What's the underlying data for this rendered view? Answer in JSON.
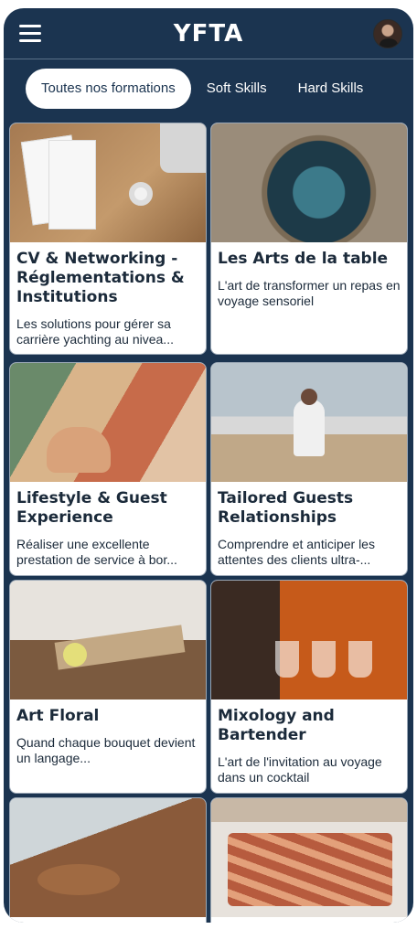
{
  "header": {
    "logo_text": "YFTA",
    "menu_icon": "hamburger-menu-icon",
    "avatar": "user-avatar"
  },
  "tabs": [
    {
      "label": "Toutes nos formations",
      "active": true
    },
    {
      "label": "Soft Skills",
      "active": false
    },
    {
      "label": "Hard Skills",
      "active": false
    }
  ],
  "courses": [
    {
      "title": "CV & Networking - Réglementations & Institutions",
      "description": "Les solutions pour gérer sa carrière yachting au nivea..."
    },
    {
      "title": "Les Arts de la table",
      "description": "L'art de transformer un repas en voyage sensoriel"
    },
    {
      "title": "Lifestyle & Guest Experience",
      "description": "Réaliser une excellente prestation de service à bor..."
    },
    {
      "title": "Tailored Guests Relationships",
      "description": "Comprendre et anticiper les attentes des clients ultra-..."
    },
    {
      "title": "Art Floral",
      "description": "Quand chaque bouquet devient un langage..."
    },
    {
      "title": "Mixology and Bartender",
      "description": "L'art de l'invitation au voyage dans un cocktail"
    },
    {
      "title": "",
      "description": ""
    },
    {
      "title": "",
      "description": ""
    }
  ],
  "colors": {
    "background": "#1b3450",
    "card": "#ffffff",
    "text": "#1b2a3a"
  }
}
